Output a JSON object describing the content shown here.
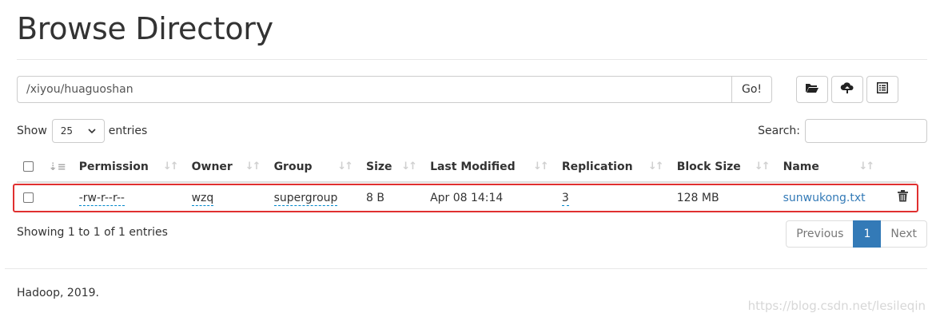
{
  "page": {
    "title": "Browse Directory"
  },
  "path_bar": {
    "value": "/xiyou/huaguoshan",
    "go_label": "Go!"
  },
  "toolbar": {
    "icons": [
      "folder-open-icon",
      "cloud-upload-icon",
      "list-alt-icon"
    ]
  },
  "length": {
    "show_label": "Show",
    "selected": "25",
    "entries_label": "entries"
  },
  "search": {
    "label": "Search:",
    "value": ""
  },
  "table": {
    "headers": [
      "Permission",
      "Owner",
      "Group",
      "Size",
      "Last Modified",
      "Replication",
      "Block Size",
      "Name"
    ],
    "rows": [
      {
        "permission": "-rw-r--r--",
        "owner": "wzq",
        "group": "supergroup",
        "size": "8 B",
        "last_modified": "Apr 08 14:14",
        "replication": "3",
        "block_size": "128 MB",
        "name": "sunwukong.txt"
      }
    ]
  },
  "info": "Showing 1 to 1 of 1 entries",
  "pagination": {
    "previous": "Previous",
    "current": "1",
    "next": "Next"
  },
  "footer": "Hadoop, 2019.",
  "watermark": "https://blog.csdn.net/lesileqin",
  "colors": {
    "link": "#337ab7",
    "active_page": "#337ab7",
    "highlight": "#e03030"
  }
}
